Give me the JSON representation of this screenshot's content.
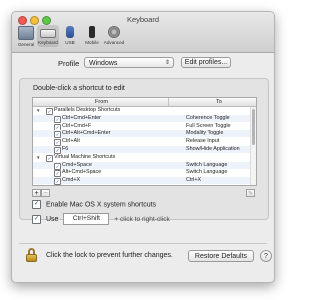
{
  "window": {
    "title": "Keyboard"
  },
  "toolbar": [
    {
      "label": "General",
      "icon": "general-icon"
    },
    {
      "label": "Keyboard",
      "icon": "keyboard-icon",
      "active": true
    },
    {
      "label": "USB",
      "icon": "usb-icon"
    },
    {
      "label": "Mobile",
      "icon": "mobile-icon"
    },
    {
      "label": "Advanced",
      "icon": "advanced-gear-icon"
    }
  ],
  "profile": {
    "label": "Profile",
    "value": "Windows",
    "edit_button": "Edit profiles..."
  },
  "shortcuts": {
    "instructions": "Double-click a shortcut to edit",
    "columns": {
      "from": "From",
      "to": "To"
    },
    "rows": [
      {
        "group": true,
        "from": "Parallels Desktop Shortcuts",
        "to": "",
        "checked": true
      },
      {
        "from": "Ctrl+Cmd+Enter",
        "to": "Coherence Toggle",
        "checked": true
      },
      {
        "from": "Ctrl+Cmd+F",
        "to": "Full Screen Toggle",
        "checked": true
      },
      {
        "from": "Ctrl+Alt+Cmd+Enter",
        "to": "Modality Toggle",
        "checked": true
      },
      {
        "from": "Ctrl+Alt",
        "to": "Release Input",
        "checked": true
      },
      {
        "from": "F6",
        "to": "Show/Hide Application",
        "checked": true
      },
      {
        "group": true,
        "from": "Virtual Machine Shortcuts",
        "to": "",
        "checked": true
      },
      {
        "from": "Cmd+Space",
        "to": "Switch Language",
        "checked": true
      },
      {
        "from": "Alt+Cmd+Space",
        "to": "Switch Language",
        "checked": true
      },
      {
        "from": "Cmd+X",
        "to": "Ctrl+X",
        "checked": true
      }
    ],
    "add_button": "+",
    "remove_button": "−",
    "edit_icon": "pencil-icon"
  },
  "options": {
    "enable_label": "Enable Mac OS X system shortcuts",
    "enable_checked": true,
    "use_label": "Use",
    "use_checked": true,
    "use_shortcut": "Ctrl+Shift",
    "use_hint": "+ click to right-click"
  },
  "footer": {
    "lock_text": "Click the lock to prevent further changes.",
    "restore_button": "Restore Defaults",
    "help_button": "?"
  }
}
